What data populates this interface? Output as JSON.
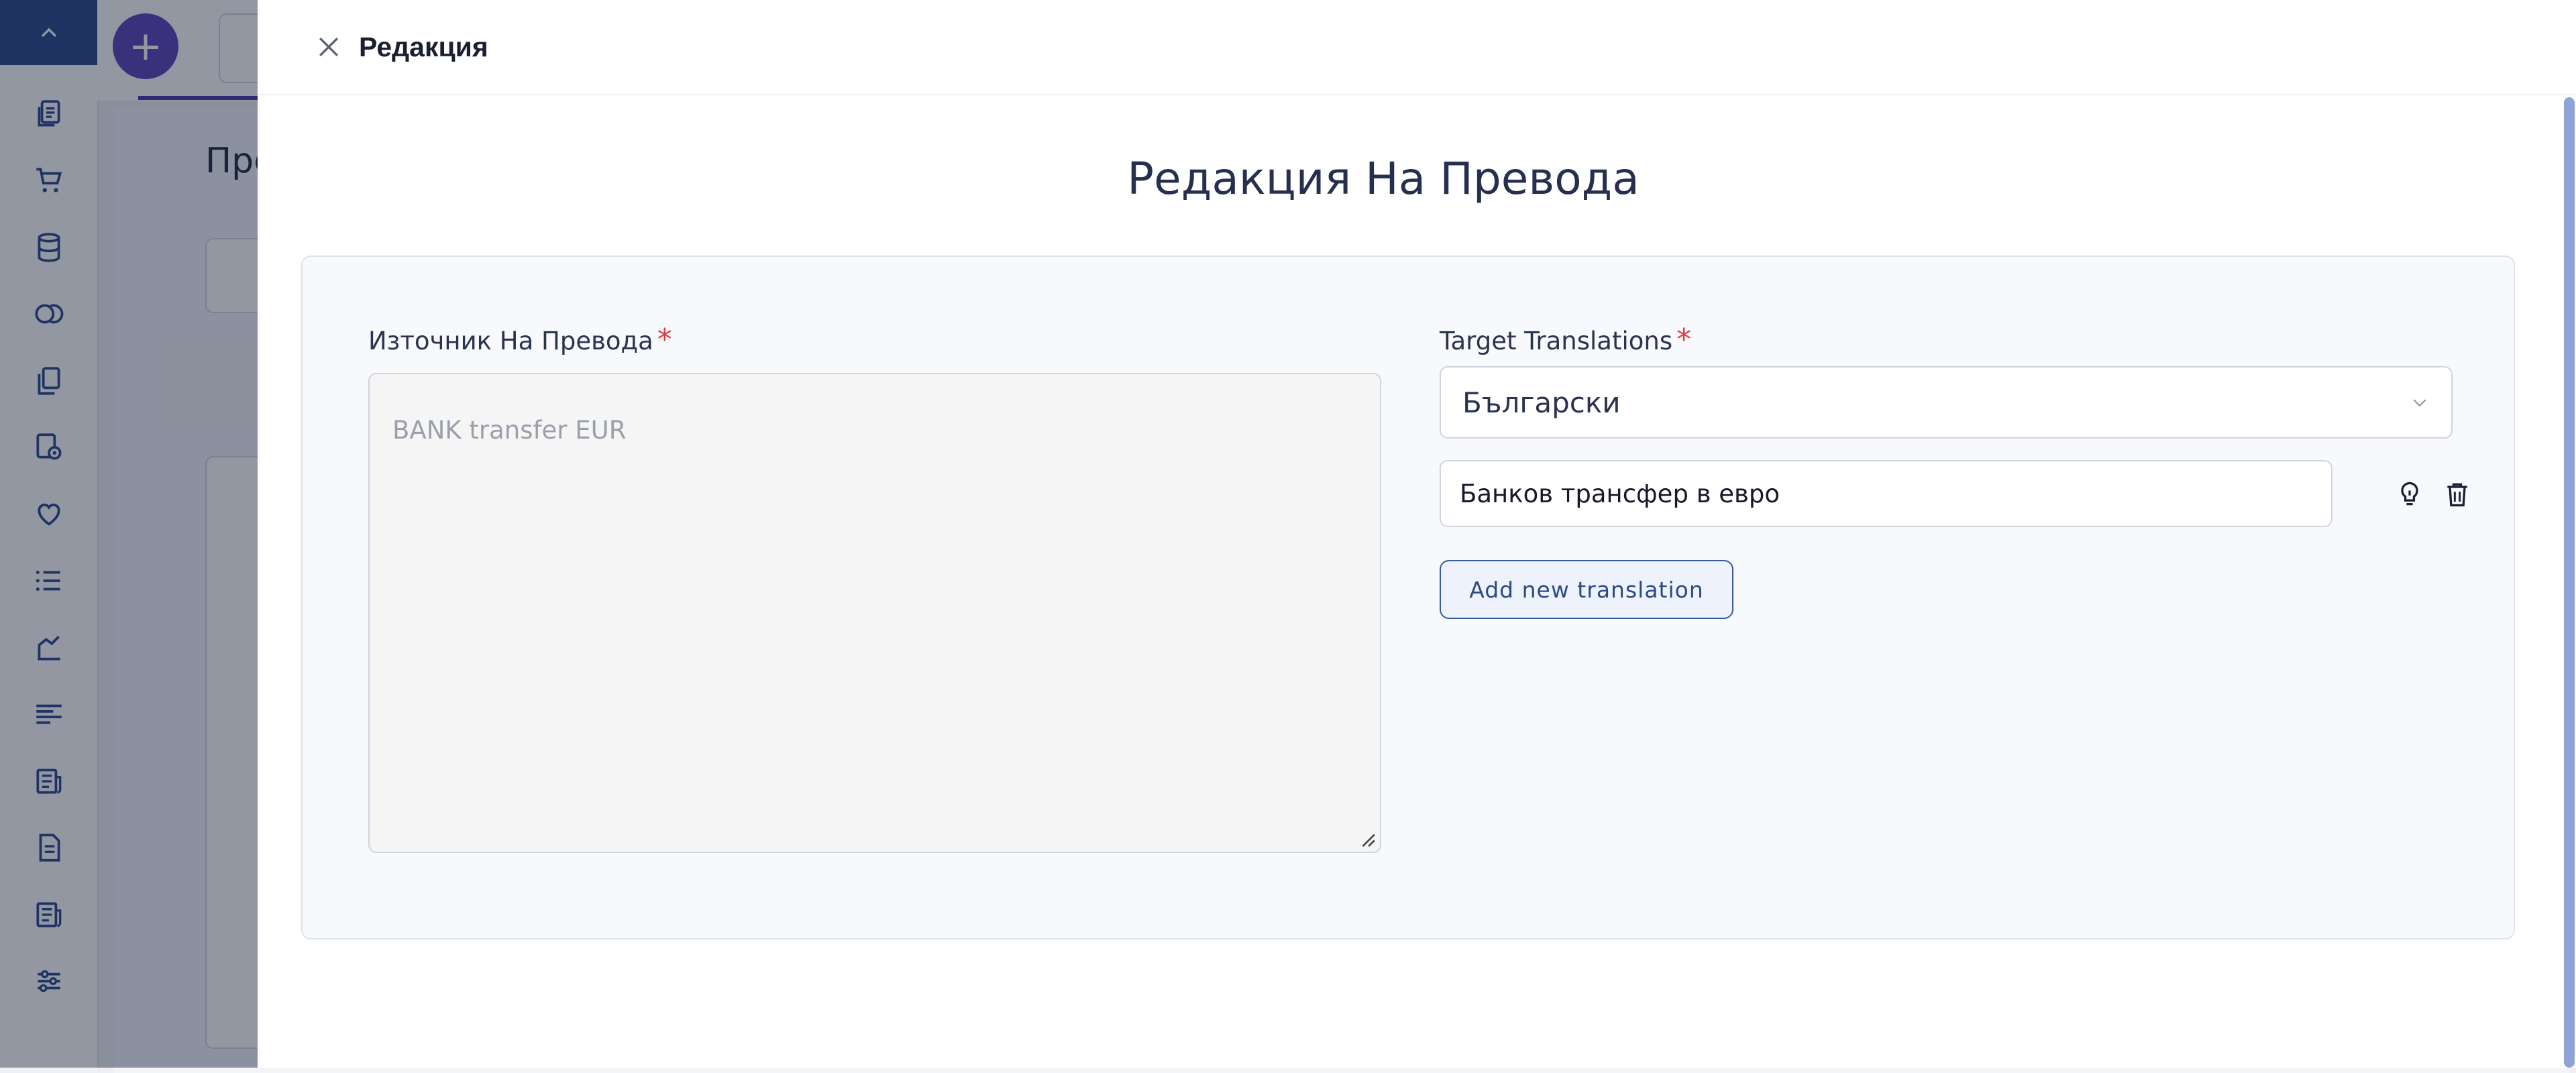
{
  "background": {
    "heading": "Пре"
  },
  "drawer": {
    "title": "Редакция",
    "form_title": "Редакция На Превода",
    "source": {
      "label": "Източник На Превода",
      "required_mark": "*",
      "value": "BANK transfer EUR"
    },
    "target": {
      "label": "Target Translations",
      "required_mark": "*",
      "selected_language": "Български",
      "translations": [
        {
          "value": "Банков трансфер в евро"
        }
      ],
      "add_button_label": "Add new translation"
    }
  },
  "icons": {
    "sidebar": [
      "chevron-up-icon",
      "documents-icon",
      "cart-icon",
      "database-icon",
      "coins-icon",
      "copy-icon",
      "settings-gear-icon",
      "heart-hand-icon",
      "list-icon",
      "chart-icon",
      "sliders-icon",
      "newspaper-icon",
      "document-icon",
      "newspaper-icon",
      "filters-icon"
    ],
    "close": "close-icon",
    "select_chevron": "chevron-down-icon",
    "suggest": "lightbulb-icon",
    "delete": "trash-icon"
  },
  "colors": {
    "brand": "#2b4a8a",
    "accent": "#5b45b8",
    "required": "#e23c3c",
    "button_border": "#3c5a98"
  }
}
